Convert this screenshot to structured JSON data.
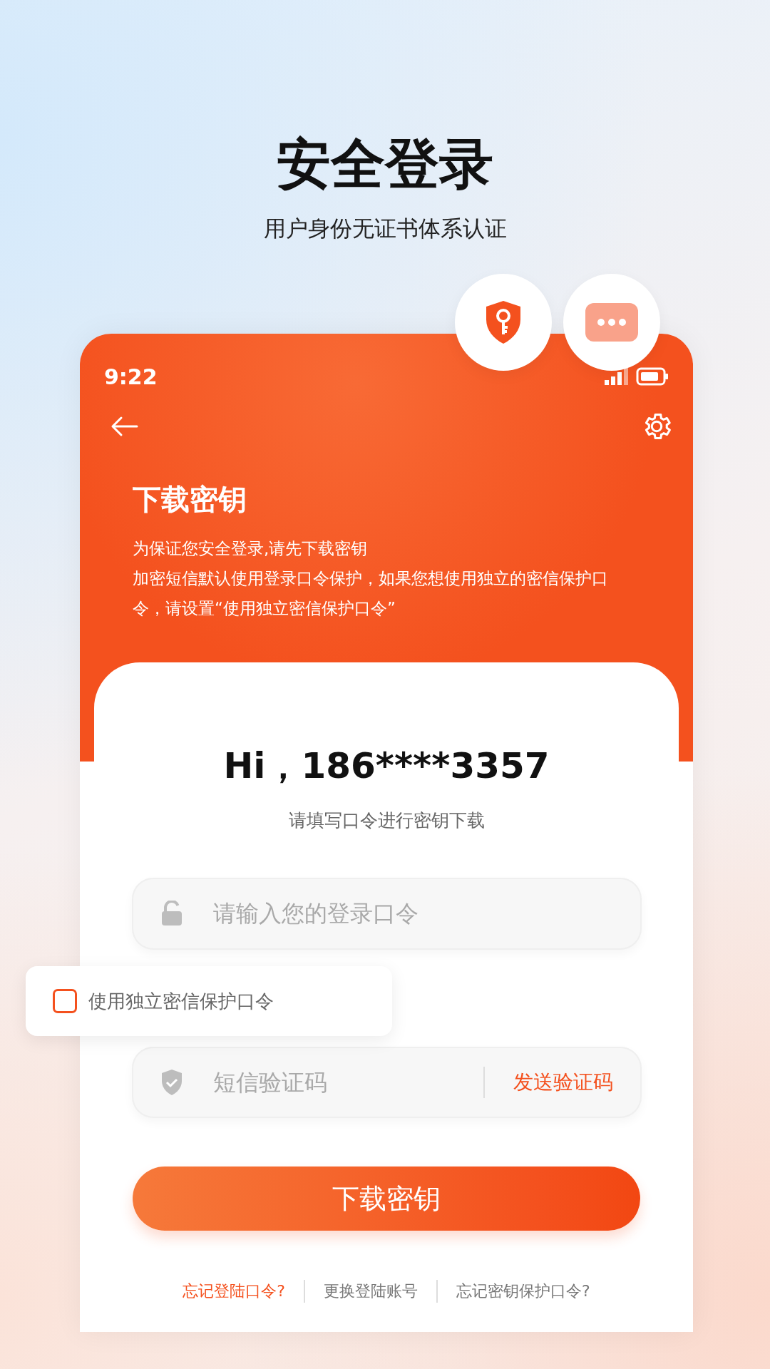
{
  "headline": {
    "title": "安全登录",
    "subtitle": "用户身份无证书体系认证"
  },
  "status_bar": {
    "time": "9:22"
  },
  "header": {
    "title": "下载密钥",
    "description": [
      "为保证您安全登录,请先下载密钥",
      "加密短信默认使用登录口令保护，如果您想使用独立的密信保护口令，请设置“使用独立密信保护口令”"
    ]
  },
  "greeting": {
    "title": "Hi，186****3357",
    "subtitle": "请填写口令进行密钥下载"
  },
  "password_field": {
    "placeholder": "请输入您的登录口令"
  },
  "option": {
    "label": "使用独立密信保护口令",
    "checked": false
  },
  "sms_field": {
    "placeholder": "短信验证码",
    "action": "发送验证码"
  },
  "submit_button": "下载密钥",
  "links": [
    {
      "label": "忘记登陆口令?",
      "highlighted": true
    },
    {
      "label": "更换登陆账号",
      "highlighted": false
    },
    {
      "label": "忘记密钥保护口令?",
      "highlighted": false
    }
  ]
}
